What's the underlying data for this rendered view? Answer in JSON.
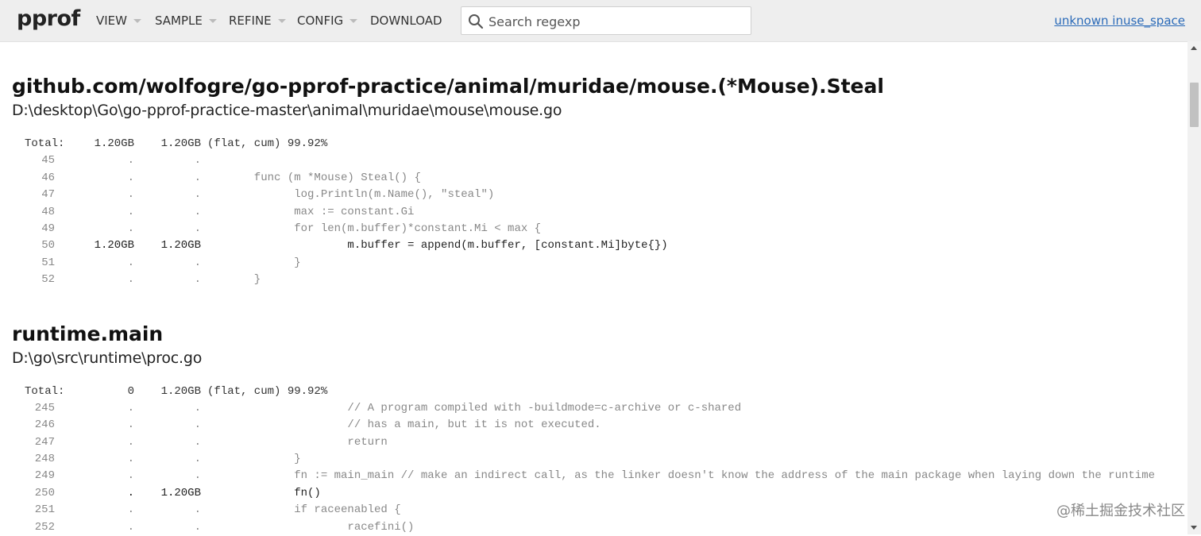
{
  "header": {
    "brand": "pprof",
    "menu": [
      "VIEW",
      "SAMPLE",
      "REFINE",
      "CONFIG",
      "DOWNLOAD"
    ],
    "search_placeholder": "Search regexp",
    "legend": "unknown inuse_space"
  },
  "sections": [
    {
      "title": "github.com/wolfogre/go-pprof-practice/animal/muridae/mouse.(*Mouse).Steal",
      "file": "D:\\desktop\\Go\\go-pprof-practice-master\\animal\\muridae\\mouse\\mouse.go",
      "total": {
        "label": "Total:",
        "flat": "1.20GB",
        "cum": "1.20GB",
        "summary": "(flat, cum) 99.92%"
      },
      "lines": [
        {
          "line": "45",
          "flat": ".",
          "cum": ".",
          "src": ""
        },
        {
          "line": "46",
          "flat": ".",
          "cum": ".",
          "src": "       func (m *Mouse) Steal() {"
        },
        {
          "line": "47",
          "flat": ".",
          "cum": ".",
          "src": "             log.Println(m.Name(), \"steal\")"
        },
        {
          "line": "48",
          "flat": ".",
          "cum": ".",
          "src": "             max := constant.Gi"
        },
        {
          "line": "49",
          "flat": ".",
          "cum": ".",
          "src": "             for len(m.buffer)*constant.Mi < max {"
        },
        {
          "line": "50",
          "flat": "1.20GB",
          "cum": "1.20GB",
          "src": "                     m.buffer = append(m.buffer, [constant.Mi]byte{})"
        },
        {
          "line": "51",
          "flat": ".",
          "cum": ".",
          "src": "             }"
        },
        {
          "line": "52",
          "flat": ".",
          "cum": ".",
          "src": "       }"
        }
      ]
    },
    {
      "title": "runtime.main",
      "file": "D:\\go\\src\\runtime\\proc.go",
      "total": {
        "label": "Total:",
        "flat": "0",
        "cum": "1.20GB",
        "summary": "(flat, cum) 99.92%"
      },
      "lines": [
        {
          "line": "245",
          "flat": ".",
          "cum": ".",
          "src": "                     // A program compiled with -buildmode=c-archive or c-shared"
        },
        {
          "line": "246",
          "flat": ".",
          "cum": ".",
          "src": "                     // has a main, but it is not executed."
        },
        {
          "line": "247",
          "flat": ".",
          "cum": ".",
          "src": "                     return"
        },
        {
          "line": "248",
          "flat": ".",
          "cum": ".",
          "src": "             }"
        },
        {
          "line": "249",
          "flat": ".",
          "cum": ".",
          "src": "             fn := main_main // make an indirect call, as the linker doesn't know the address of the main package when laying down the runtime"
        },
        {
          "line": "250",
          "flat": ".",
          "cum": "1.20GB",
          "src": "             fn()"
        },
        {
          "line": "251",
          "flat": ".",
          "cum": ".",
          "src": "             if raceenabled {"
        },
        {
          "line": "252",
          "flat": ".",
          "cum": ".",
          "src": "                     racefini()"
        }
      ]
    }
  ],
  "watermark": "@稀土掘金技术社区"
}
